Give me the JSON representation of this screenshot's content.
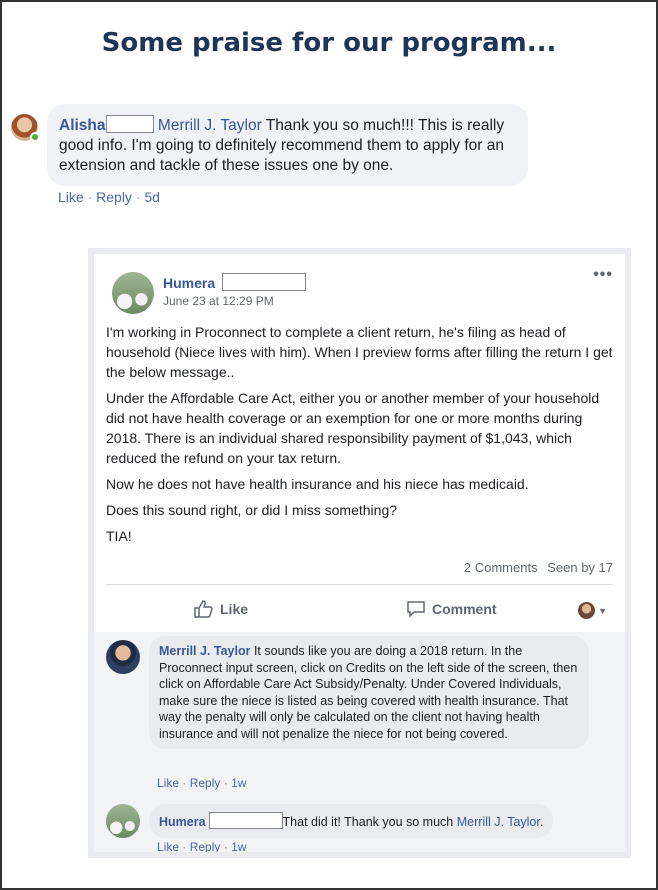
{
  "heading": "Some praise for our program...",
  "comment1": {
    "author": "Alisha",
    "mention": "Merrill J. Taylor",
    "text": "Thank you so much!!! This is really good info. I'm going to definitely recommend them to apply for an extension and tackle of these issues one by one.",
    "like": "Like",
    "reply": "Reply",
    "time": "5d"
  },
  "post": {
    "author": "Humera",
    "date": "June 23 at 12:29 PM",
    "paragraphs": [
      "I'm working in Proconnect to complete a client return, he's filing as head of household (Niece lives with him). When I preview forms after filling the return I get the below message..",
      "Under the Affordable Care Act, either you or another member of your household did not have health coverage or an exemption for one or more months during 2018. There is an individual shared responsibility payment of $1,043, which reduced the refund on your tax return.",
      "Now he does not have health insurance and his niece has medicaid.",
      "Does this sound right, or did I miss something?",
      "TIA!"
    ],
    "comments_count": "2 Comments",
    "seen_by": "Seen by 17",
    "like_label": "Like",
    "comment_label": "Comment",
    "menu_icon": "more-options-icon"
  },
  "reply1": {
    "author": "Merrill J. Taylor",
    "text": "It sounds like you are doing a 2018 return. In the Proconnect input screen, click on Credits on the left side of the screen, then click on Affordable Care Act Subsidy/Penalty. Under Covered Individuals, make sure the niece is listed as being covered with health insurance. That way the penalty will only be calculated on the client not having health insurance and will not penalize the niece for not being covered.",
    "like": "Like",
    "reply": "Reply",
    "time": "1w"
  },
  "reply2": {
    "author": "Humera",
    "text": "That did it! Thank you so much",
    "mention": "Merrill J. Taylor",
    "end": ".",
    "like": "Like",
    "reply": "Reply",
    "time": "1w"
  }
}
